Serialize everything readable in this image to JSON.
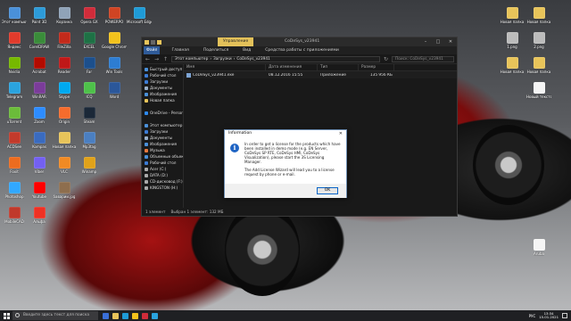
{
  "desktop": {
    "icons": [
      {
        "label": "Этот компьютер",
        "color": "#4a90d9"
      },
      {
        "label": "Paint 3D",
        "color": "#2d9bd8"
      },
      {
        "label": "Корзина",
        "color": "#8fa3b8"
      },
      {
        "label": "Opera GX",
        "color": "#d02c3a"
      },
      {
        "label": "POWERPO",
        "color": "#d04423"
      },
      {
        "label": "Microsoft Edge",
        "color": "#1f9bd6"
      },
      {
        "label": "Яндекс",
        "color": "#e23b2c"
      },
      {
        "label": "CorelDRAW",
        "color": "#3a8c3a"
      },
      {
        "label": "FileZilla",
        "color": "#c22a1b"
      },
      {
        "label": "EXCEL",
        "color": "#1e7145"
      },
      {
        "label": "Google Chrome",
        "color": "#f2c21c"
      },
      {
        "label": "Nvidia",
        "color": "#76b900"
      },
      {
        "label": "Acrobat",
        "color": "#b30b00"
      },
      {
        "label": "Reader",
        "color": "#c01818"
      },
      {
        "label": "Far",
        "color": "#1c4f8c"
      },
      {
        "label": "Win Tools",
        "color": "#2d7dd2"
      },
      {
        "label": "Telegram",
        "color": "#2aa3de"
      },
      {
        "label": "WinRAR",
        "color": "#7b3c9a"
      },
      {
        "label": "Skype",
        "color": "#00a9f0"
      },
      {
        "label": "ICQ",
        "color": "#4ec14a"
      },
      {
        "label": "Word",
        "color": "#2b579a"
      },
      {
        "label": "uTorrent",
        "color": "#6bbc3a"
      },
      {
        "label": "Zoom",
        "color": "#2d8cff"
      },
      {
        "label": "Origin",
        "color": "#f56c2d"
      },
      {
        "label": "Steam",
        "color": "#1b2838"
      },
      {
        "label": "ACDSee",
        "color": "#c23a2b"
      },
      {
        "label": "Kompas",
        "color": "#3a6bbf"
      },
      {
        "label": "Новая папка",
        "color": "#e8c45a"
      },
      {
        "label": "Mp3tag",
        "color": "#4b7fc1"
      },
      {
        "label": "Foxit",
        "color": "#ec6c1f"
      },
      {
        "label": "Viber",
        "color": "#7360f2"
      },
      {
        "label": "VLC",
        "color": "#f08a24"
      },
      {
        "label": "Winamp",
        "color": "#e0a21a"
      },
      {
        "label": "Photoshop",
        "color": "#31a8ff"
      },
      {
        "label": "Youtube",
        "color": "#ff0000"
      },
      {
        "label": "баварии.jpg",
        "color": "#8e6e4e"
      },
      {
        "label": "MobileCAD",
        "color": "#c0392b"
      },
      {
        "label": "Альфа",
        "color": "#ef3124"
      },
      {
        "label": "Новая папка",
        "color": "#e8c45a"
      },
      {
        "label": "Новая папка",
        "color": "#e8c45a"
      },
      {
        "label": "1.png",
        "color": "#bcbcbc"
      },
      {
        "label": "2.png",
        "color": "#bcbcbc"
      },
      {
        "label": "Новая папка",
        "color": "#e8c45a"
      },
      {
        "label": "Новая папка",
        "color": "#e8c45a"
      },
      {
        "label": "Новый текстовый",
        "color": "#f5f5f5"
      },
      {
        "label": "Aruba",
        "color": "#f5f5f5"
      }
    ]
  },
  "explorer": {
    "title": "CoDeSys_v23941",
    "context_tab": "Управление",
    "ribbon_tabs": [
      "Файл",
      "Главная",
      "Поделиться",
      "Вид",
      "Средства работы с приложениями"
    ],
    "address": [
      "Этот компьютер",
      "Загрузки",
      "CoDeSys_v23941"
    ],
    "search_placeholder": "Поиск: CoDeSys_v23941",
    "nav_items": [
      {
        "label": "Быстрый доступ",
        "color": "#4a90d9"
      },
      {
        "label": "Рабочий стол",
        "color": "#3b7bd4"
      },
      {
        "label": "Загрузки",
        "color": "#3b7bd4"
      },
      {
        "label": "Документы",
        "color": "#9ab0c8"
      },
      {
        "label": "Изображения",
        "color": "#4a90d9"
      },
      {
        "label": "Новая папка",
        "color": "#e8c45a"
      },
      {
        "label": "",
        "color": "#191919"
      },
      {
        "label": "OneDrive - Person",
        "color": "#2d89ef"
      },
      {
        "label": "",
        "color": "#191919"
      },
      {
        "label": "Этот компьютер",
        "color": "#4a90d9"
      },
      {
        "label": "Загрузки",
        "color": "#3b7bd4"
      },
      {
        "label": "Документы",
        "color": "#9ab0c8"
      },
      {
        "label": "Изображения",
        "color": "#4a90d9"
      },
      {
        "label": "Музыка",
        "color": "#e8783c"
      },
      {
        "label": "Объемные объекты",
        "color": "#4a90d9"
      },
      {
        "label": "Рабочий стол",
        "color": "#3b7bd4"
      },
      {
        "label": "Acer (C:)",
        "color": "#aaaaaa"
      },
      {
        "label": "DATA (D:)",
        "color": "#aaaaaa"
      },
      {
        "label": "CD-дисковод (F:)",
        "color": "#aaaaaa"
      },
      {
        "label": "KINGSTON (H:)",
        "color": "#aaaaaa"
      }
    ],
    "columns": [
      "Имя",
      "Дата изменения",
      "Тип",
      "Размер"
    ],
    "files": [
      {
        "name": "CoDeSys_v23941.exe",
        "date": "08.12.2016 15:55",
        "type": "Приложение",
        "size": "135 956 КБ"
      }
    ],
    "status": [
      "1 элемент",
      "Выбран 1 элемент: 132 МБ"
    ]
  },
  "dialog": {
    "title": "Information",
    "close": "✕",
    "paragraphs": [
      "In order to get a license for the products which have been installed in demo mode (e.g. EN Server, CoDeSys SP RTE, CoDeSys HMI, CoDeSys Visualization), please start the 3S Licensing Manager.",
      "The Add License Wizard will lead you to a license request by phone or e-mail."
    ],
    "ok_label": "OK"
  },
  "taskbar": {
    "search_placeholder": "Введите здесь текст для поиска",
    "apps": [
      "#3a6fd8",
      "#e8c45a",
      "#1f9bd6",
      "#f2c21c",
      "#d02c3a",
      "#2aa3de"
    ],
    "language": "РУС",
    "time": "13:34",
    "date": "15.01.2021"
  }
}
